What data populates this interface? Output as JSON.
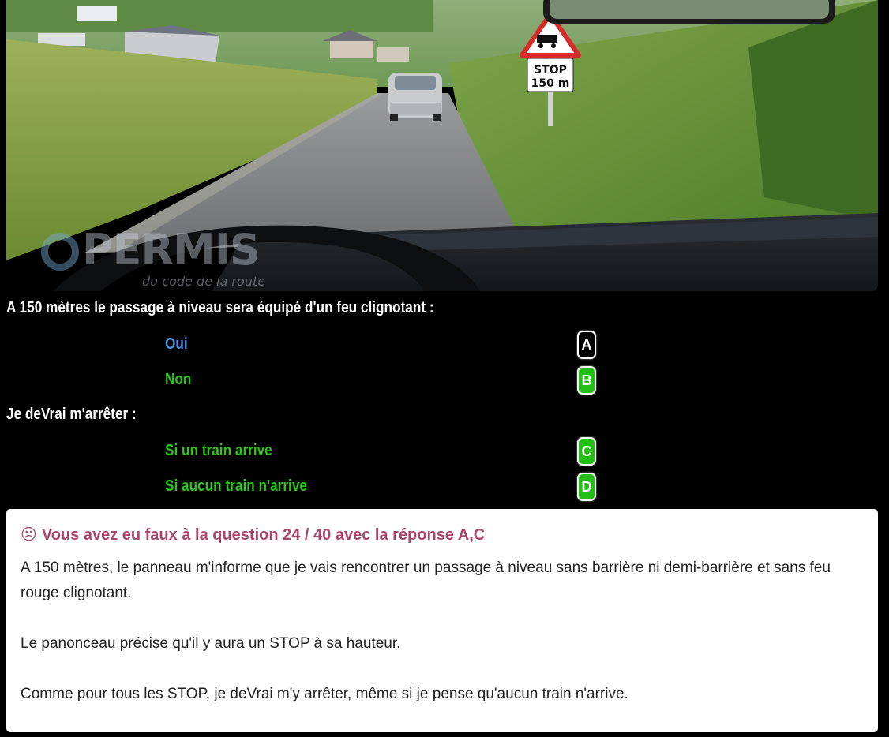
{
  "scene": {
    "sign_panel_lines": [
      "STOP",
      "150 m"
    ],
    "watermark": "PERMIS",
    "watermark_sub": "du code de la route"
  },
  "questions": [
    {
      "text": "A 150 mètres le passage à niveau sera équipé d'un feu clignotant :",
      "options": [
        {
          "label": "Oui",
          "letter": "A",
          "color": "#4a8fe0",
          "badge_bg": "#000000"
        },
        {
          "label": "Non",
          "letter": "B",
          "color": "#2ec51a",
          "badge_bg": "#22c014"
        }
      ]
    },
    {
      "text": "Je deVrai m'arrêter :",
      "options": [
        {
          "label": "Si un train arrive",
          "letter": "C",
          "color": "#2ec51a",
          "badge_bg": "#22c014"
        },
        {
          "label": "Si aucun train n'arrive",
          "letter": "D",
          "color": "#2ec51a",
          "badge_bg": "#22c014"
        }
      ]
    }
  ],
  "feedback": {
    "icon": "☹",
    "title": "Vous avez eu faux à la question 24 / 40 avec la réponse A,C",
    "title_color": "#a8456a",
    "paragraphs": [
      "A 150 mètres, le panneau m'informe que je vais rencontrer un passage à niveau sans barrière ni demi-barrière et sans feu rouge clignotant.",
      "Le panonceau précise qu'il y aura un STOP à sa hauteur.",
      "Comme pour tous les STOP, je deVrai m'y arrêter, même si je pense qu'aucun train n'arrive."
    ]
  }
}
